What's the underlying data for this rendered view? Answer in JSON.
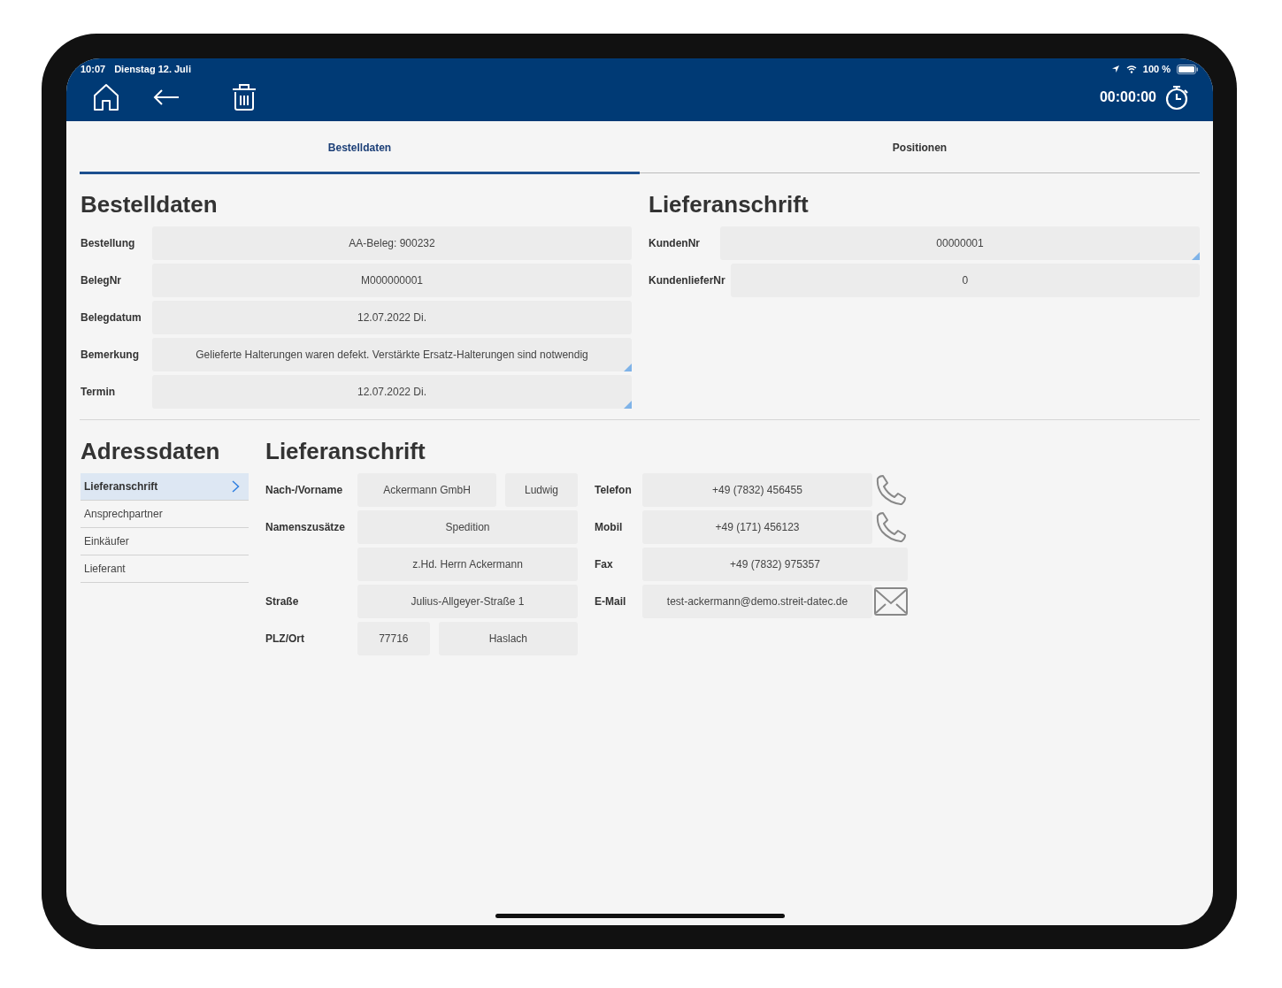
{
  "status_bar": {
    "time": "10:07",
    "date": "Dienstag 12. Juli",
    "battery": "100 %"
  },
  "toolbar": {
    "timer": "00:00:00"
  },
  "tabs": [
    {
      "label": "Bestelldaten",
      "selected": true
    },
    {
      "label": "Positionen",
      "selected": false
    }
  ],
  "bestelldaten": {
    "title": "Bestelldaten",
    "fields": [
      {
        "label": "Bestellung",
        "value": "AA-Beleg: 900232",
        "expandable": false
      },
      {
        "label": "BelegNr",
        "value": "M000000001",
        "expandable": false
      },
      {
        "label": "Belegdatum",
        "value": "12.07.2022 Di.",
        "expandable": false
      },
      {
        "label": "Bemerkung",
        "value": "Gelieferte Halterungen waren defekt. Verstärkte Ersatz-Halterungen sind notwendig",
        "expandable": true
      },
      {
        "label": "Termin",
        "value": "12.07.2022 Di.",
        "expandable": true
      }
    ]
  },
  "lieferanschrift_kopf": {
    "title": "Lieferanschrift",
    "fields": [
      {
        "label": "KundenNr",
        "value": "00000001",
        "expandable": true
      },
      {
        "label": "KundenlieferNr",
        "value": "0",
        "expandable": false
      }
    ]
  },
  "adressdaten": {
    "title": "Adressdaten",
    "items": [
      {
        "label": "Lieferanschrift",
        "selected": true
      },
      {
        "label": "Ansprechpartner",
        "selected": false
      },
      {
        "label": "Einkäufer",
        "selected": false
      },
      {
        "label": "Lieferant",
        "selected": false
      }
    ]
  },
  "adresse": {
    "title": "Lieferanschrift",
    "rows": [
      {
        "label": "Nach-/Vorname",
        "values": [
          "Ackermann GmbH",
          "Ludwig"
        ]
      },
      {
        "label": "Namenszusätze",
        "values": [
          "Spedition"
        ]
      },
      {
        "values": [
          "z.Hd. Herrn Ackermann"
        ]
      },
      {
        "label": "Straße",
        "values": [
          "Julius-Allgeyer-Straße 1"
        ]
      },
      {
        "label": "PLZ/Ort",
        "values": [
          "77716",
          "Haslach"
        ]
      }
    ],
    "contacts": [
      {
        "label": "Telefon",
        "value": "+49 (7832) 456455",
        "kind": "phone"
      },
      {
        "label": "Mobil",
        "value": "+49 (171) 456123",
        "kind": "phone"
      },
      {
        "label": "Fax",
        "value": "+49 (7832) 975357",
        "kind": "none"
      },
      {
        "label": "E-Mail",
        "value": "test-ackermann@demo.streit-datec.de",
        "kind": "mail"
      }
    ]
  }
}
